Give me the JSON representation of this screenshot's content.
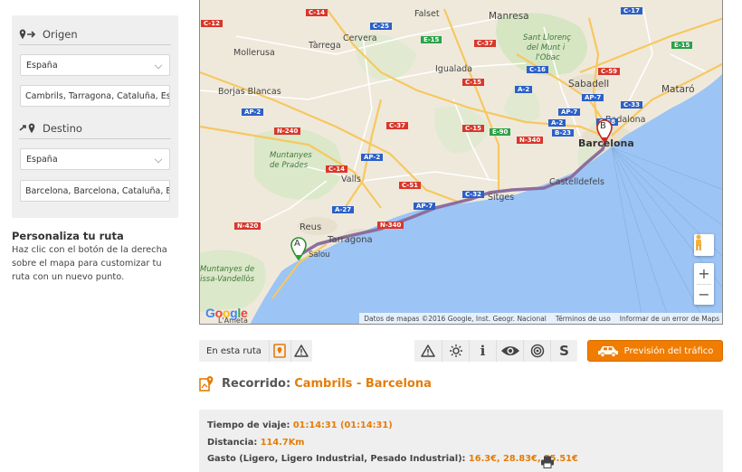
{
  "route_form": {
    "origin": {
      "label": "Origen",
      "country": "España",
      "address": "Cambrils, Tarragona, Cataluña, Esp"
    },
    "destination": {
      "label": "Destino",
      "country": "España",
      "address": "Barcelona, Barcelona, Cataluña, Es"
    }
  },
  "customize": {
    "title": "Personaliza tu ruta",
    "text": "Haz clic con el botón de la derecha sobre el mapa para customizar tu ruta con un nuevo punto."
  },
  "map": {
    "attribution": "Datos de mapas ©2016 Google, Inst. Geogr. Nacional",
    "terms": "Términos de uso",
    "report": "Informar de un error de Maps",
    "google_logo": "Google",
    "zoom_in": "+",
    "zoom_out": "−",
    "marker_a": "A",
    "marker_b": "B",
    "places": {
      "mollerusa": "Mollerusa",
      "tarrega": "Tàrrega",
      "cervera": "Cervera",
      "falset": "Falset",
      "manresa": "Manresa",
      "sant_llorenc_1": "Sant Llorenç",
      "sant_llorenc_2": "del Munt i",
      "sant_llorenc_3": "l'Obac",
      "borjas": "Borjas Blancas",
      "igualada": "Igualada",
      "sabadell": "Sabadell",
      "mataro": "Mataró",
      "badalona": "Badalona",
      "barcelona": "Barcelona",
      "muntanyes1": "Muntanyes",
      "muntanyes2": "de Prades",
      "valls": "Valls",
      "castelldefels": "Castelldefels",
      "sitges": "Sitges",
      "reus": "Reus",
      "tarragona": "Tarragona",
      "salou": "Salou",
      "vandellos1": "Muntanyes de",
      "vandellos2": "issa-Vandellòs",
      "ametlla": "L'Ameta"
    },
    "road_shields": {
      "c14a": "C-14",
      "c25": "C-25",
      "c37a": "C-37",
      "c17": "C-17",
      "e15a": "E-15",
      "c12": "C-12",
      "c16": "C-16",
      "c15a": "C-15",
      "a2a": "A-2",
      "c59": "C-59",
      "ap7a": "AP-7",
      "c33": "C-33",
      "c58": "C-58",
      "b23": "B-23",
      "a2b": "A-2",
      "ap7b": "AP-7",
      "c37b": "C-37",
      "c15b": "C-15",
      "e90": "E-90",
      "n340a": "N-340",
      "n240": "N-240",
      "c14b": "C-14",
      "ap2": "AP-2",
      "ap2b": "AP-2",
      "a27": "A-27",
      "c51": "C-51",
      "ap7c": "AP-7",
      "c32": "C-32",
      "n420": "N-420",
      "n340b": "N-340",
      "e15b": "E-15"
    }
  },
  "toolbar": {
    "on_route": "En esta ruta",
    "traffic_button": "Previsión del tráfico",
    "info_icon_text": "i",
    "s_icon_text": "S"
  },
  "route": {
    "label": "Recorrido:",
    "value": "Cambrils - Barcelona",
    "travel_time_label": "Tiempo de viaje:",
    "travel_time_value": "01:14:31 (01:14:31)",
    "distance_label": "Distancia:",
    "distance_value": "114.7Km",
    "cost_label": "Gasto (Ligero, Ligero Industrial, Pesado Industrial):",
    "cost_value": "16.3€, 28.83€, 35.51€"
  },
  "colors": {
    "accent": "#f07c00",
    "accent_text": "#e57c08",
    "panel_bg": "#efefef",
    "sea": "#9cc4f5",
    "route_line": "#8b6f9e"
  }
}
